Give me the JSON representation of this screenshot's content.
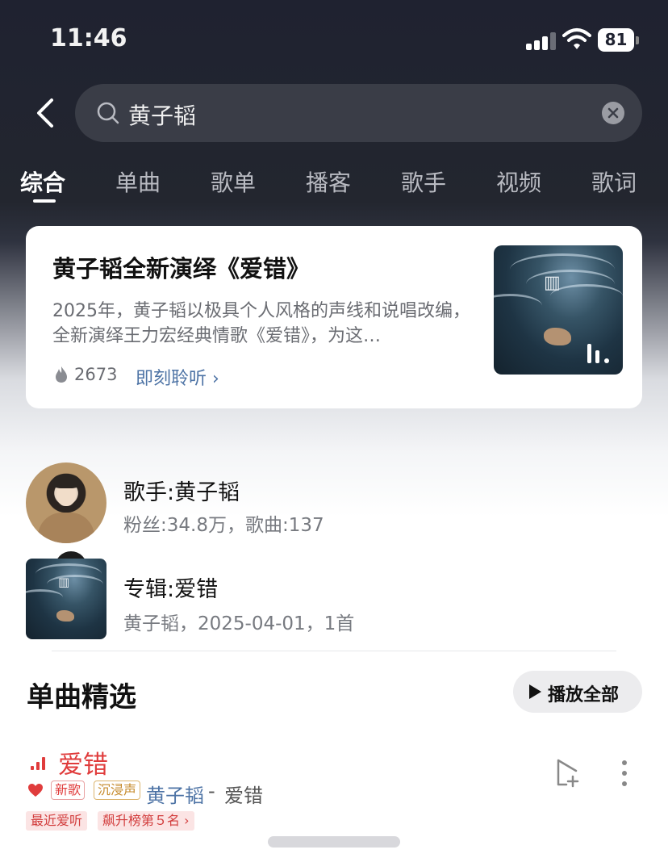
{
  "status_bar": {
    "time": "11:46",
    "battery": "81"
  },
  "search": {
    "query": "黄子韬"
  },
  "tabs": [
    {
      "label": "综合",
      "active": true
    },
    {
      "label": "单曲"
    },
    {
      "label": "歌单"
    },
    {
      "label": "播客"
    },
    {
      "label": "歌手"
    },
    {
      "label": "视频"
    },
    {
      "label": "歌词"
    }
  ],
  "feature": {
    "title": "黄子韬全新演绎《爱错》",
    "description": "2025年，黄子韬以极具个人风格的声线和说唱改编，全新演绎王力宏经典情歌《爱错》，为这…",
    "heat": "2673",
    "link": "即刻聆听"
  },
  "artist": {
    "name": "歌手:黄子韬",
    "meta": "粉丝:34.8万，歌曲:137"
  },
  "album": {
    "name": "专辑:爱错",
    "meta": "黄子韬，2025-04-01，1首"
  },
  "songs_section": {
    "title": "单曲精选",
    "play_all": "播放全部"
  },
  "song": {
    "title": "爱错",
    "tags": [
      "新歌",
      "沉浸声"
    ],
    "artist": "黄子韬",
    "separator": "-",
    "album": "爱错",
    "badges": [
      "最近爱听",
      "飙升榜第５名"
    ]
  },
  "colors": {
    "accent_red": "#e03c3c",
    "link_blue": "#4d73a5",
    "header_bg": "#1f2230"
  }
}
